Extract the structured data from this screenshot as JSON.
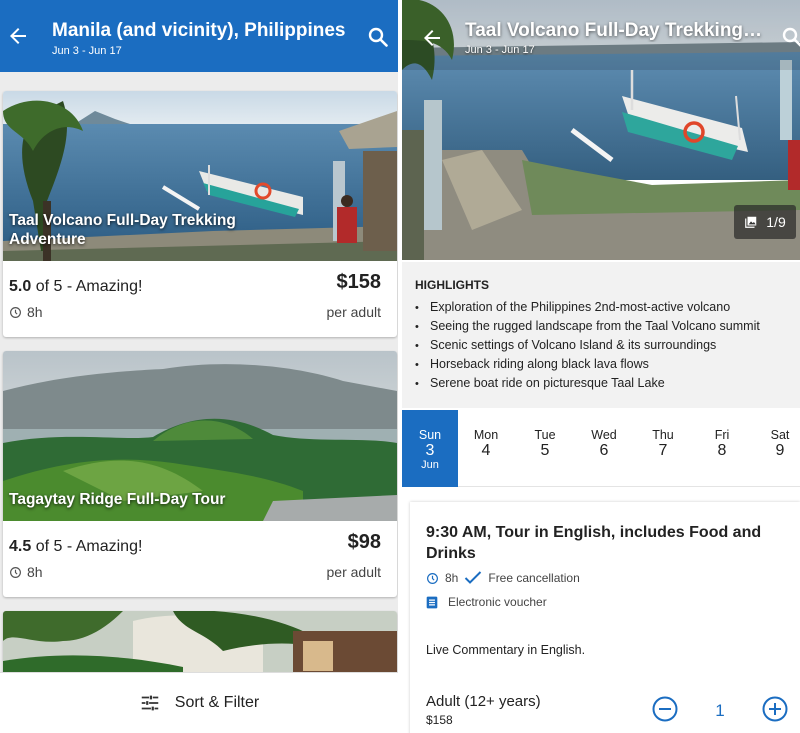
{
  "left": {
    "header": {
      "title": "Manila (and vicinity), Philippines",
      "dates": "Jun 3 - Jun 17"
    },
    "cards": [
      {
        "title": "Taal Volcano Full-Day Trekking Adventure",
        "score": "5.0",
        "rating_suffix": " of 5 - Amazing!",
        "duration": "8h",
        "price": "$158",
        "price_unit": "per adult"
      },
      {
        "title": "Tagaytay Ridge Full-Day Tour",
        "score": "4.5",
        "rating_suffix": " of 5 - Amazing!",
        "duration": "8h",
        "price": "$98",
        "price_unit": "per adult"
      }
    ],
    "sort_filter_label": "Sort & Filter"
  },
  "right": {
    "header": {
      "title": "Taal Volcano Full-Day Trekking Adventure",
      "dates": "Jun 3 - Jun 17"
    },
    "photo_counter": "1/9",
    "highlights": {
      "heading": "HIGHLIGHTS",
      "items": [
        "Exploration of the Philippines 2nd-most-active volcano",
        "Seeing the rugged landscape from the Taal Volcano summit",
        "Scenic settings of Volcano Island & its surroundings",
        "Horseback riding along black lava flows",
        "Serene boat ride on picturesque Taal Lake"
      ]
    },
    "days": [
      {
        "name": "Sun",
        "date": "3",
        "month": "Jun"
      },
      {
        "name": "Mon",
        "date": "4"
      },
      {
        "name": "Tue",
        "date": "5"
      },
      {
        "name": "Wed",
        "date": "6"
      },
      {
        "name": "Thu",
        "date": "7"
      },
      {
        "name": "Fri",
        "date": "8"
      },
      {
        "name": "Sat",
        "date": "9"
      }
    ],
    "offer": {
      "title": "9:30 AM, Tour in English, includes Food and Drinks",
      "duration": "8h",
      "cancellation": "Free cancellation",
      "voucher": "Electronic voucher",
      "commentary": "Live Commentary in English.",
      "ticket_label": "Adult (12+ years)",
      "ticket_price": "$158",
      "quantity": "1"
    }
  },
  "colors": {
    "brand_blue": "#1b6dc1",
    "panel_gray": "#f2f2f2"
  },
  "icons": [
    "back-arrow-icon",
    "search-icon",
    "clock-icon",
    "checkmark-icon",
    "voucher-icon",
    "gallery-icon",
    "sliders-icon",
    "minus-circle-icon",
    "plus-circle-icon"
  ]
}
